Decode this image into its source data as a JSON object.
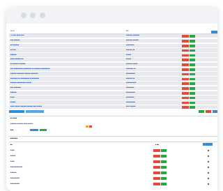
{
  "window": {
    "traffic_lights": [
      "close",
      "minimize",
      "zoom"
    ]
  },
  "top_bar": {
    "left_label": "ow N",
    "mid_label": "Rin",
    "right_label": "",
    "add_label": ""
  },
  "rows": [
    {
      "name": "▪ ■ ■■■ ■■■■ ■■■",
      "value": "■■■■■■ ■■■■■■■"
    },
    {
      "name": "■■■ ■■■■■■",
      "value": "■■■■■■ ■■■■■■"
    },
    {
      "name": "■■ ■■■■■■",
      "value": "■■■■■■■■"
    },
    {
      "name": "■■ ■■■",
      "value": "■■■■■■ ■■"
    },
    {
      "name": "■■■■■■",
      "value": "■■■■■"
    },
    {
      "name": "■■■■ ■■■■■■ ■■",
      "value": "■■■■■"
    },
    {
      "name": "■■ ■■■■■■ ■■■■■■",
      "value": "■■■■■■ ■■■■■"
    },
    {
      "name": "■■■ ■■■■■■■■■ ■■■■■■■■ ■■ ■■■■■■ ■■■■■■■■■",
      "value": "■■■■■■■ ■■"
    },
    {
      "name": "■■■■■■ ■■■■■■■ ■■■■■■ ■■■■■■■",
      "value": "■■■■■■■■■"
    },
    {
      "name": "■■■■■■■ ■■ ■■■■■■■■■ ■■■■■■■■■",
      "value": "■■■■■■ ■■"
    },
    {
      "name": "■■■■■■ ■■■■■■■■■ ■■■■■",
      "value": "■■■■■■■■■■"
    },
    {
      "name": "■■■ ■■■■■■■",
      "value": "■■■■■■■■"
    },
    {
      "name": "■■■■■■",
      "value": "■■■■■■■■■"
    },
    {
      "name": "■■■■",
      "value": "■■■■■■■■"
    },
    {
      "name": "■■■■■",
      "value": "■■■■■■■■■"
    },
    {
      "name": "■■■■ ■■■■■ ■■■■■■ ■■■■■■ ■■■ ■■■■■",
      "value": "■■■ ■■■■■■"
    }
  ],
  "row_delete_label": "",
  "row_edit_label": "",
  "bottom_actions": {
    "primary_label": "",
    "secondary_label": "",
    "right_green": "",
    "right_red": "",
    "right_blue": ""
  },
  "section2": {
    "title": "■■ ■■■■",
    "subtitle": "■■■■■■ ■■■■■■ ■■■■ ■■■■■",
    "field_label": "■■■",
    "btn_a": "",
    "btn_b": ""
  },
  "section3": {
    "title": "■■■■■■■",
    "col_name": "■■",
    "col_value": "■ ■■",
    "add_label": "",
    "items": [
      "■■■■",
      "■■■■■",
      "■■■■",
      "■■■■■■■■■■■■",
      "■■■■■■",
      "■■■■■■■■■",
      "■■■■■■■■■"
    ]
  },
  "colors": {
    "link": "#3467c4",
    "red": "#e04b3c",
    "green": "#27a845",
    "blue": "#2e8fd8",
    "orange": "#f39c3a"
  }
}
